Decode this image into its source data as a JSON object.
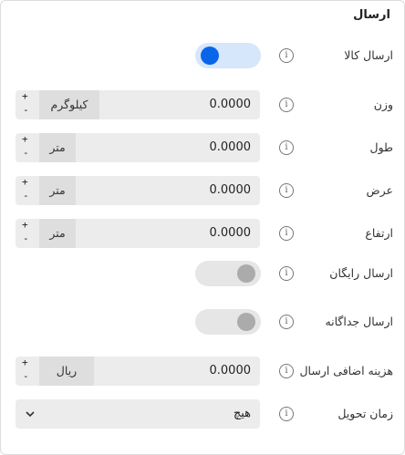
{
  "section": {
    "title": "ارسال"
  },
  "ship_item": {
    "label": "ارسال کالا",
    "enabled": true
  },
  "weight": {
    "label": "وزن",
    "value": "0.0000",
    "unit": "کیلوگرم",
    "plus": "+",
    "minus": "-"
  },
  "length": {
    "label": "طول",
    "value": "0.0000",
    "unit": "متر",
    "plus": "+",
    "minus": "-"
  },
  "width": {
    "label": "عرض",
    "value": "0.0000",
    "unit": "متر",
    "plus": "+",
    "minus": "-"
  },
  "height": {
    "label": "ارتفاع",
    "value": "0.0000",
    "unit": "متر",
    "plus": "+",
    "minus": "-"
  },
  "free_shipping": {
    "label": "ارسال رایگان",
    "enabled": false
  },
  "separate_shipping": {
    "label": "ارسال جداگانه",
    "enabled": false
  },
  "extra_cost": {
    "label": "هزینه اضافی ارسال",
    "value": "0.0000",
    "unit": "ریال",
    "plus": "+",
    "minus": "-"
  },
  "delivery_time": {
    "label": "زمان تحویل",
    "selected": "هیچ"
  },
  "info_glyph": "i",
  "colors": {
    "toggle_on_track": "#d6e6fb",
    "toggle_on_knob": "#0a66e8",
    "toggle_off_track": "#e6e6e6",
    "toggle_off_knob": "#ababab",
    "field_bg": "#ececec"
  }
}
